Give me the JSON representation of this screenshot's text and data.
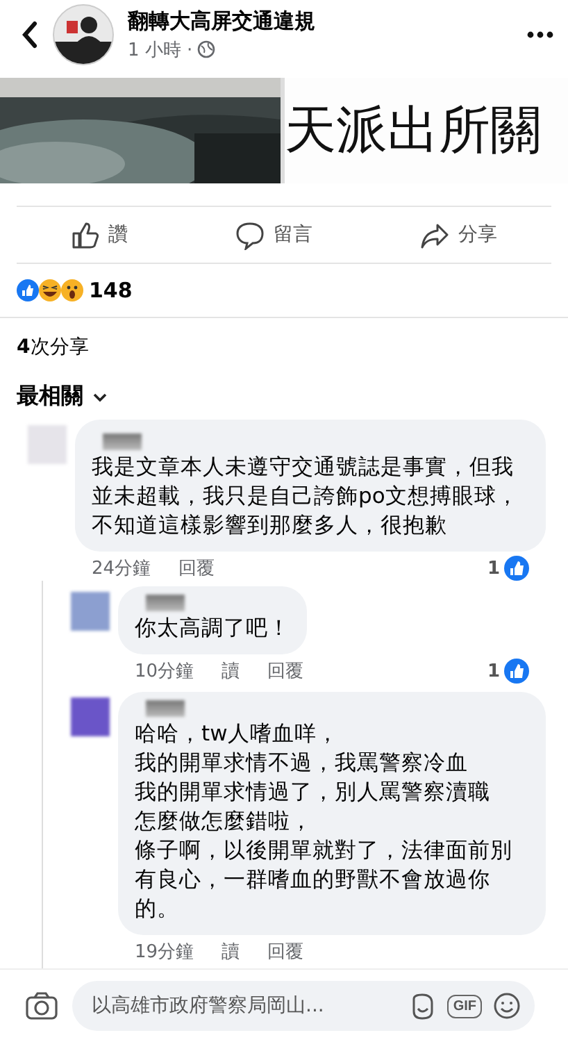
{
  "header": {
    "page_name": "翻轉大高屏交通違規",
    "time": "1 小時 ·"
  },
  "post_image": {
    "kind": "picture",
    "text": "天派出所關"
  },
  "actions": [
    {
      "label": "讚"
    },
    {
      "label": "留言"
    },
    {
      "label": "分享"
    }
  ],
  "reactions": {
    "count": "148"
  },
  "shares": "**4**次分享",
  "sort": {
    "label": "最相關"
  },
  "comments": [
    {
      "color": "#e6e4ea",
      "text": "我是文章本人未遵守交通號誌是事實，但我並未超載，我只是自己誇飾po文想搏眼球，不知道這樣影響到那麼多人，很抱歉",
      "time": "24分鐘",
      "actions": [
        "回覆"
      ],
      "likes": "1",
      "children": [
        {
          "color": "#8c9fd0",
          "text": "你太高調了吧！",
          "time": "10分鐘",
          "actions": [
            "讀",
            "回覆"
          ],
          "likes": "1"
        },
        {
          "color": "#6a55c8",
          "lines": [
            "哈哈，tw人嗜血咩，",
            "我的開單求情不過，我罵警察冷血",
            "我的開單求情過了，別人罵警察瀆職",
            "怎麼做怎麼錯啦，",
            "條子啊，以後開單就對了，法律面前別有良心，一群嗜血的野獸不會放過你的。"
          ],
          "time": "19分鐘",
          "actions": [
            "讀",
            "回覆"
          ]
        }
      ]
    }
  ],
  "composer": {
    "placeholder": "以高雄市政府警察局岡山...",
    "gif": "GIF"
  }
}
